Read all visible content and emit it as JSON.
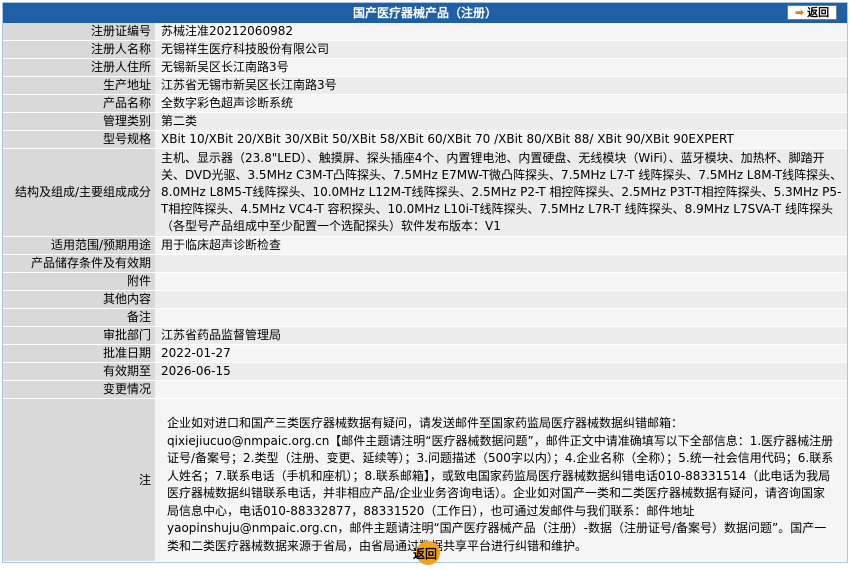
{
  "header": {
    "title": "国产医疗器械产品（注册）",
    "back_label": "返回"
  },
  "rows": [
    {
      "label": "注册证编号",
      "value": "苏械注准20212060982"
    },
    {
      "label": "注册人名称",
      "value": "无锡祥生医疗科技股份有限公司"
    },
    {
      "label": "注册人住所",
      "value": "无锡新吴区长江南路3号"
    },
    {
      "label": "生产地址",
      "value": "江苏省无锡市新吴区长江南路3号"
    },
    {
      "label": "产品名称",
      "value": "全数字彩色超声诊断系统"
    },
    {
      "label": "管理类别",
      "value": "第二类"
    },
    {
      "label": "型号规格",
      "value": "XBit 10/XBit 20/XBit 30/XBit 50/XBit 58/XBit 60/XBit 70 /XBit 80/XBit 88/ XBit 90/XBit 90EXPERT"
    },
    {
      "label": "结构及组成/主要组成成分",
      "value": "主机、显示器（23.8\"LED）、触摸屏、探头插座4个、内置锂电池、内置硬盘、无线模块（WiFi）、蓝牙模块、加热杯、脚踏开关、DVD光驱、3.5MHz C3M-T凸阵探头、7.5MHz E7MW-T微凸阵探头、7.5MHz L7-T 线阵探头、7.5MHz L8M-T线阵探头、8.0MHz L8M5-T线阵探头、10.0MHz L12M-T线阵探头、2.5MHz P2-T 相控阵探头、2.5MHz P3T-T相控阵探头、5.3MHz P5-T相控阵探头、4.5MHz VC4-T 容积探头、10.0MHz L10i-T线阵探头、7.5MHz L7R-T 线阵探头、8.9MHz L7SVA-T 线阵探头（各型号产品组成中至少配置一个选配探头）软件发布版本：V1"
    },
    {
      "label": "适用范围/预期用途",
      "value": "用于临床超声诊断检查"
    },
    {
      "label": "产品储存条件及有效期",
      "value": ""
    },
    {
      "label": "附件",
      "value": ""
    },
    {
      "label": "其他内容",
      "value": ""
    },
    {
      "label": "备注",
      "value": ""
    },
    {
      "label": "审批部门",
      "value": "江苏省药品监督管理局"
    },
    {
      "label": "批准日期",
      "value": "2022-01-27"
    },
    {
      "label": "有效期至",
      "value": "2026-06-15"
    },
    {
      "label": "变更情况",
      "value": ""
    }
  ],
  "note": {
    "label": "注",
    "text": "企业如对进口和国产三类医疗器械数据有疑问，请发送邮件至国家药监局医疗器械数据纠错邮箱：qixiejiucuo@nmpaic.org.cn【邮件主题请注明“医疗器械数据问题”，邮件正文中请准确填写以下全部信息：1.医疗器械注册证号/备案号；2.类型（注册、变更、延续等）；3.问题描述（500字以内）；4.企业名称（全称）；5.统一社会信用代码；6.联系人姓名；7.联系电话（手机和座机）；8.联系邮箱】，或致电国家药监局医疗器械数据纠错电话010-88331514（此电话为我局医疗器械数据纠错联系电话，并非相应产品/企业业务咨询电话）。企业如对国产一类和二类医疗器械数据有疑问，请咨询国家局信息中心，电话010-88332877，88331520（工作日），也可通过发邮件与我们联系：邮件地址yaopinshuju@nmpaic.org.cn，邮件主题请注明“国产医疗器械产品（注册）-数据（注册证号/备案号）数据问题”。国产一类和二类医疗器械数据来源于省局，由省局通过数据共享平台进行纠错和维护。"
  },
  "footer": {
    "back_label": "返回"
  },
  "colors": {
    "header_bg": "#1f5fa6",
    "label_bg": "#d9d9d9",
    "accent": "#f3a21d"
  }
}
